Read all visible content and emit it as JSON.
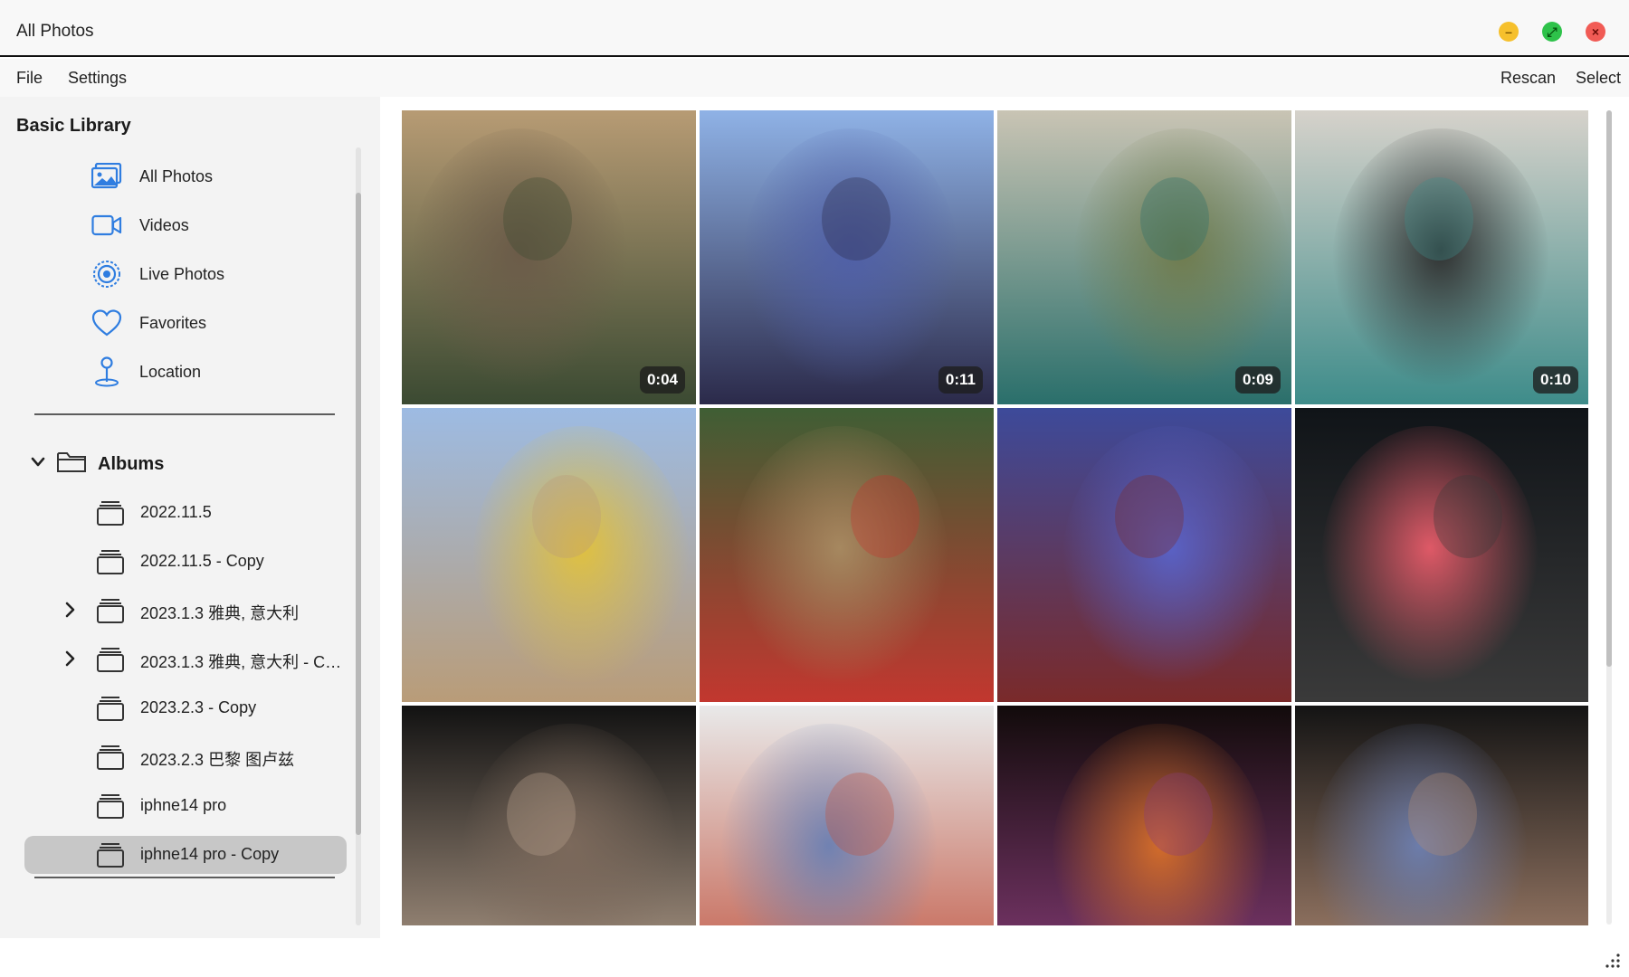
{
  "window": {
    "title": "All Photos",
    "controls": [
      "minimize",
      "maximize",
      "close"
    ]
  },
  "menu": {
    "left": [
      "File",
      "Settings"
    ],
    "right": [
      "Rescan",
      "Select"
    ]
  },
  "sidebar": {
    "section_title": "Basic Library",
    "library_items": [
      {
        "label": "All Photos",
        "icon": "photos-icon"
      },
      {
        "label": "Videos",
        "icon": "video-camera-icon"
      },
      {
        "label": "Live Photos",
        "icon": "live-photo-icon"
      },
      {
        "label": "Favorites",
        "icon": "heart-icon"
      },
      {
        "label": "Location",
        "icon": "location-pin-icon"
      }
    ],
    "albums_header": "Albums",
    "albums": [
      {
        "label": "2022.11.5",
        "expandable": false,
        "selected": false
      },
      {
        "label": "2022.11.5 - Copy",
        "expandable": false,
        "selected": false
      },
      {
        "label": "2023.1.3 雅典, 意大利",
        "expandable": true,
        "selected": false
      },
      {
        "label": "2023.1.3 雅典, 意大利 - Co...",
        "expandable": true,
        "selected": false
      },
      {
        "label": "2023.2.3 - Copy",
        "expandable": false,
        "selected": false
      },
      {
        "label": "2023.2.3 巴黎 图卢兹",
        "expandable": false,
        "selected": false
      },
      {
        "label": "iphne14 pro",
        "expandable": false,
        "selected": false
      },
      {
        "label": "iphne14 pro - Copy",
        "expandable": false,
        "selected": true
      }
    ]
  },
  "photos": [
    {
      "kind": "video",
      "duration": "0:04",
      "palette": [
        "#b79b74",
        "#6a5a48",
        "#3b4a32"
      ]
    },
    {
      "kind": "video",
      "duration": "0:11",
      "palette": [
        "#8fb2e6",
        "#4f5fa8",
        "#2b2a4a"
      ]
    },
    {
      "kind": "video",
      "duration": "0:09",
      "palette": [
        "#c9c4b4",
        "#6f7a4a",
        "#2a6f6b"
      ]
    },
    {
      "kind": "video",
      "duration": "0:10",
      "palette": [
        "#d6d2cb",
        "#2a2a2a",
        "#3e8c8a"
      ]
    },
    {
      "kind": "photo",
      "duration": "",
      "palette": [
        "#9dbbe3",
        "#e2c13a",
        "#b99c78"
      ]
    },
    {
      "kind": "photo",
      "duration": "",
      "palette": [
        "#3f5e34",
        "#a88b62",
        "#c2372f"
      ]
    },
    {
      "kind": "photo",
      "duration": "",
      "palette": [
        "#3d4a9a",
        "#5a63c9",
        "#7a2a2a"
      ]
    },
    {
      "kind": "photo",
      "duration": "",
      "palette": [
        "#101418",
        "#e85c6a",
        "#3a3a3a"
      ]
    },
    {
      "kind": "photo",
      "duration": "",
      "palette": [
        "#121212",
        "#7d6a5c",
        "#b9a38f"
      ]
    },
    {
      "kind": "photo",
      "duration": "",
      "palette": [
        "#e9e9e9",
        "#6b80b3",
        "#c0533f"
      ]
    },
    {
      "kind": "photo",
      "duration": "",
      "palette": [
        "#120b0b",
        "#d9702a",
        "#8a3d7a"
      ]
    },
    {
      "kind": "photo",
      "duration": "",
      "palette": [
        "#141414",
        "#6d7fb0",
        "#b38d76"
      ]
    }
  ]
}
